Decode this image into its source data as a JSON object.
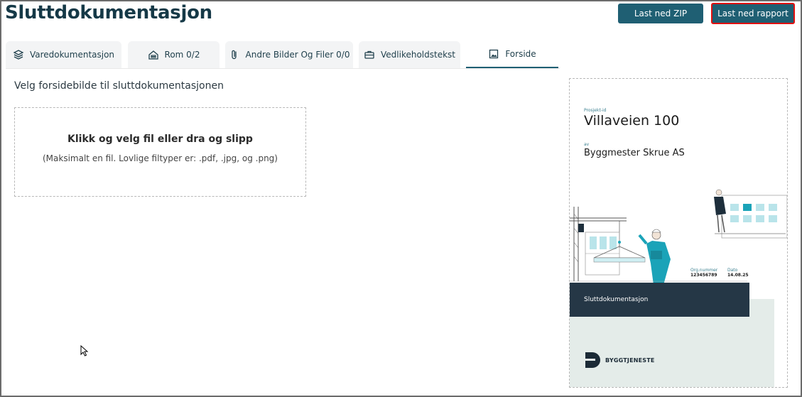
{
  "header": {
    "title": "Sluttdokumentasjon",
    "btn_zip": "Last ned ZIP",
    "btn_rapport": "Last ned rapport"
  },
  "tabs": [
    {
      "label": "Varedokumentasjon",
      "icon": "layers-icon"
    },
    {
      "label": "Rom 0/2",
      "icon": "house-icon"
    },
    {
      "label": "Andre Bilder Og Filer 0/0",
      "icon": "paperclip-icon"
    },
    {
      "label": "Vedlikeholdstekst",
      "icon": "toolbox-icon"
    },
    {
      "label": "Forside",
      "icon": "image-icon",
      "active": true
    }
  ],
  "main": {
    "section_title": "Velg forsidebilde til sluttdokumentasjonen",
    "dropzone_title": "Klikk og velg fil eller dra og slipp",
    "dropzone_hint": "(Maksimalt en fil. Lovlige filtyper er: .pdf, .jpg, og .png)"
  },
  "preview": {
    "project_label": "Prosjekt-id",
    "project_name": "Villaveien 100",
    "by_label": "av",
    "company": "Byggmester Skrue AS",
    "org_label": "Org.nummer",
    "org_value": "123456789",
    "date_label": "Dato",
    "date_value": "14.08.25",
    "band_title": "Sluttdokumentasjon",
    "logo_text": "BYGGTJENESTE"
  },
  "colors": {
    "brand": "#1f5f73",
    "title": "#153947",
    "highlight": "#e01010",
    "band": "#253746",
    "accent": "#1aa3b8"
  }
}
